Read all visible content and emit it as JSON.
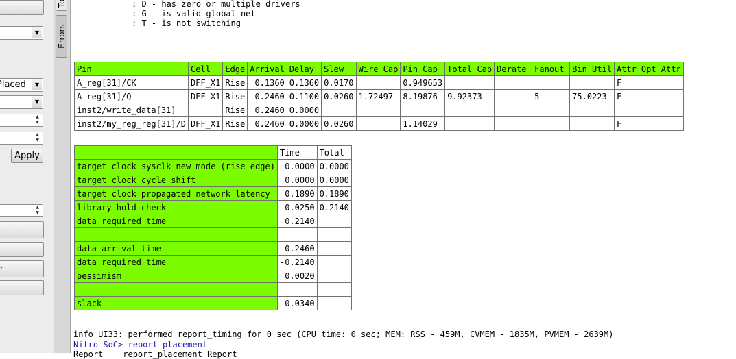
{
  "left_panel": {
    "combo_placed": "Placed",
    "apply_label": "Apply"
  },
  "tabs": {
    "top_tab": "To",
    "errors_tab": "Errors"
  },
  "console": {
    "legend_lines": [
      ": D - has zero or multiple drivers",
      ": G - is valid global net",
      ": T - is not switching"
    ],
    "pin_table": {
      "headers": [
        "Pin",
        "Cell",
        "Edge",
        "Arrival",
        "Delay",
        "Slew",
        "Wire Cap",
        "Pin Cap",
        "Total Cap",
        "Derate",
        "Fanout",
        "Bin Util",
        "Attr",
        "Opt Attr"
      ],
      "rows": [
        [
          "A_reg[31]/CK",
          "DFF_X1",
          "Rise",
          "0.1360",
          "0.1360",
          "0.0170",
          "",
          "0.949653",
          "",
          "",
          "",
          "",
          "F",
          ""
        ],
        [
          "A_reg[31]/Q",
          "DFF_X1",
          "Rise",
          "0.2460",
          "0.1100",
          "0.0260",
          "1.72497",
          "8.19876",
          "9.92373",
          "",
          "5",
          "75.0223",
          "F",
          ""
        ],
        [
          "inst2/write_data[31]",
          "",
          "Rise",
          "0.2460",
          "0.0000",
          "",
          "",
          "",
          "",
          "",
          "",
          "",
          "",
          ""
        ],
        [
          "inst2/my_reg_reg[31]/D",
          "DFF_X1",
          "Rise",
          "0.2460",
          "0.0000",
          "0.0260",
          "",
          "1.14029",
          "",
          "",
          "",
          "",
          "F",
          ""
        ]
      ]
    },
    "summary_table": {
      "headers": [
        "",
        "Time",
        "Total"
      ],
      "rows": [
        [
          "target clock sysclk_new_mode (rise edge)",
          "0.0000",
          "0.0000"
        ],
        [
          "target clock cycle shift",
          "0.0000",
          "0.0000"
        ],
        [
          "target clock propagated network latency",
          "0.1890",
          "0.1890"
        ],
        [
          "library hold check",
          "0.0250",
          "0.2140"
        ],
        [
          "data required time",
          "0.2140",
          ""
        ],
        [
          "",
          "",
          ""
        ],
        [
          "data arrival time",
          "0.2460",
          ""
        ],
        [
          "data required time",
          "-0.2140",
          ""
        ],
        [
          "pessimism",
          "0.0020",
          ""
        ],
        [
          "",
          "",
          ""
        ],
        [
          "slack",
          "0.0340",
          ""
        ]
      ]
    },
    "info_line": "info UI33: performed report_timing for 0 sec (CPU time: 0 sec; MEM: RSS - 459M, CVMEM - 1835M, PVMEM - 2639M)",
    "prompt_line": "Nitro-SoC> report_placement",
    "cut_line": "Report    report_placement Report"
  },
  "colors": {
    "table_header_green": "#7cfc00",
    "prompt_blue": "#1b1bb0"
  }
}
